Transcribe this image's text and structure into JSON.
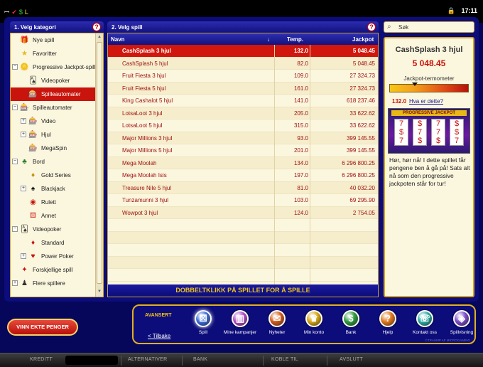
{
  "statusbar": {
    "left_icons": [
      "ꟷ",
      "✔",
      "$",
      "L"
    ],
    "right_icon": "lock-icon",
    "time": "17:11"
  },
  "category": {
    "header": "1. Velg kategori",
    "help": "?",
    "items": [
      {
        "label": "Nye spill",
        "indent": 1,
        "expander": "",
        "icon": "gift-icon",
        "icon_char": "🎁",
        "icon_color": "#e33"
      },
      {
        "label": "Favoritter",
        "indent": 1,
        "expander": "",
        "icon": "star-icon",
        "icon_char": "★",
        "icon_color": "#e8b817"
      },
      {
        "label": "Progressive Jackpot-spill",
        "indent": 1,
        "expander": "−",
        "icon": "jackpot-icon",
        "icon_char": "🪙",
        "icon_color": "#e8a317"
      },
      {
        "label": "Videopoker",
        "indent": 2,
        "expander": "",
        "icon": "cards-icon",
        "icon_char": "🂡",
        "icon_color": "#333"
      },
      {
        "label": "Spilleautomater",
        "indent": 2,
        "expander": "",
        "icon": "slot-icon",
        "icon_char": "🎰",
        "icon_color": "#c8140c",
        "selected": true
      },
      {
        "label": "Spilleautomater",
        "indent": 1,
        "expander": "−",
        "icon": "slot-icon",
        "icon_char": "🎰",
        "icon_color": "#c8140c"
      },
      {
        "label": "Video",
        "indent": 2,
        "expander": "+",
        "icon": "slot-icon",
        "icon_char": "🎰",
        "icon_color": "#c8140c"
      },
      {
        "label": "Hjul",
        "indent": 2,
        "expander": "+",
        "icon": "reel-icon",
        "icon_char": "🎰",
        "icon_color": "#c8140c"
      },
      {
        "label": "MegaSpin",
        "indent": 2,
        "expander": "",
        "icon": "megaspin-icon",
        "icon_char": "🎰",
        "icon_color": "#c8140c"
      },
      {
        "label": "Bord",
        "indent": 1,
        "expander": "−",
        "icon": "table-icon",
        "icon_char": "♣",
        "icon_color": "#2a7d2a"
      },
      {
        "label": "Gold Series",
        "indent": 2,
        "expander": "",
        "icon": "gold-icon",
        "icon_char": "♦",
        "icon_color": "#c8900c"
      },
      {
        "label": "Blackjack",
        "indent": 2,
        "expander": "+",
        "icon": "blackjack-icon",
        "icon_char": "♠",
        "icon_color": "#111"
      },
      {
        "label": "Rulett",
        "indent": 2,
        "expander": "",
        "icon": "roulette-icon",
        "icon_char": "◉",
        "icon_color": "#c8140c"
      },
      {
        "label": "Annet",
        "indent": 2,
        "expander": "",
        "icon": "dice-icon",
        "icon_char": "⚄",
        "icon_color": "#c8140c"
      },
      {
        "label": "Videopoker",
        "indent": 1,
        "expander": "−",
        "icon": "cards-icon",
        "icon_char": "🂡",
        "icon_color": "#333"
      },
      {
        "label": "Standard",
        "indent": 2,
        "expander": "",
        "icon": "card-icon",
        "icon_char": "♦",
        "icon_color": "#c8140c"
      },
      {
        "label": "Power Poker",
        "indent": 2,
        "expander": "+",
        "icon": "powerpoker-icon",
        "icon_char": "♥",
        "icon_color": "#c8140c"
      },
      {
        "label": "Forskjellige spill",
        "indent": 1,
        "expander": "",
        "icon": "misc-icon",
        "icon_char": "✦",
        "icon_color": "#c8140c"
      },
      {
        "label": "Flere spillere",
        "indent": 1,
        "expander": "+",
        "icon": "multiplayer-icon",
        "icon_char": "♟",
        "icon_color": "#333"
      }
    ]
  },
  "games": {
    "header": "2. Velg spill",
    "help": "?",
    "col_name": "Navn",
    "col_sort": "↓",
    "col_temp": "Temp.",
    "col_jackpot": "Jackpot",
    "rows": [
      {
        "name": "CashSplash 3 hjul",
        "temp": "132.0",
        "jackpot": "5 048.45",
        "selected": true
      },
      {
        "name": "CashSplash 5 hjul",
        "temp": "82.0",
        "jackpot": "5 048.45"
      },
      {
        "name": "Fruit Fiesta 3 hjul",
        "temp": "109.0",
        "jackpot": "27 324.73"
      },
      {
        "name": "Fruit Fiesta 5 hjul",
        "temp": "161.0",
        "jackpot": "27 324.73"
      },
      {
        "name": "King Cashalot 5 hjul",
        "temp": "141.0",
        "jackpot": "618 237.46"
      },
      {
        "name": "LotsaLoot 3 hjul",
        "temp": "205.0",
        "jackpot": "33 622.62"
      },
      {
        "name": "LotsaLoot 5 hjul",
        "temp": "315.0",
        "jackpot": "33 622.62"
      },
      {
        "name": "Major Millions 3 hjul",
        "temp": "93.0",
        "jackpot": "399 145.55"
      },
      {
        "name": "Major Millions 5 hjul",
        "temp": "201.0",
        "jackpot": "399 145.55"
      },
      {
        "name": "Mega Moolah",
        "temp": "134.0",
        "jackpot": "6 296 800.25"
      },
      {
        "name": "Mega Moolah Isis",
        "temp": "197.0",
        "jackpot": "6 296 800.25"
      },
      {
        "name": "Treasure Nile 5 hjul",
        "temp": "81.0",
        "jackpot": "40 032.20"
      },
      {
        "name": "Tunzamunni 3 hjul",
        "temp": "103.0",
        "jackpot": "69 295.90"
      },
      {
        "name": "Wowpot 3 hjul",
        "temp": "124.0",
        "jackpot": "2 754.05"
      },
      {
        "name": "",
        "temp": "",
        "jackpot": ""
      },
      {
        "name": "",
        "temp": "",
        "jackpot": ""
      },
      {
        "name": "",
        "temp": "",
        "jackpot": ""
      },
      {
        "name": "",
        "temp": "",
        "jackpot": ""
      },
      {
        "name": "",
        "temp": "",
        "jackpot": ""
      }
    ],
    "footer": "DOBBELTKLIKK PÅ SPILLET FOR Å SPILLE"
  },
  "search": {
    "placeholder": "Søk"
  },
  "info": {
    "title": "CashSplash 3 hjul",
    "amount": "5 048.45",
    "meter_label": "Jackpot-termometer",
    "meter_value": "132.0",
    "meter_level": 0.32,
    "what_link": "Hva er dette?",
    "thumb_banner": "PROGRESSIVE JACKPOT",
    "description": "Hør, hør nå! I dette spillet får pengene ben å gå på! Sats alt nå som den progressive jackpoten står for tur!"
  },
  "real_money": "VINN EKTE PENGER",
  "nav": {
    "advanced": "AVANSERT",
    "back": "< Tilbake",
    "buttons": [
      {
        "label": "Spill",
        "icon": "dice-icon",
        "glyph": "⚄",
        "color": "#3a6ad8",
        "active": true
      },
      {
        "label": "Mine kampanjer",
        "icon": "gift-icon",
        "glyph": "▥",
        "color": "#b14ac6"
      },
      {
        "label": "Nyheter",
        "icon": "news-icon",
        "glyph": "✉",
        "color": "#d45a18"
      },
      {
        "label": "Min konto",
        "icon": "account-icon",
        "glyph": "♛",
        "color": "#d6a411"
      },
      {
        "label": "Bank",
        "icon": "dollar-icon",
        "glyph": "$",
        "color": "#2a9a3a"
      },
      {
        "label": "Hjelp",
        "icon": "help-icon",
        "glyph": "?",
        "color": "#e0761a"
      },
      {
        "label": "Kontakt oss",
        "icon": "contact-icon",
        "glyph": "☏",
        "color": "#2aa8a0"
      },
      {
        "label": "Spillvisning",
        "icon": "gameview-icon",
        "glyph": "◈",
        "color": "#7a4ac8"
      }
    ],
    "copyright": "©TRAUMP AF MICROGAMING"
  },
  "bottombar": {
    "credit": "KREDITT",
    "alternatives": "ALTERNATIVER",
    "bank": "BANK",
    "connect": "KOBLE TIL",
    "exit": "AVSLUTT"
  }
}
